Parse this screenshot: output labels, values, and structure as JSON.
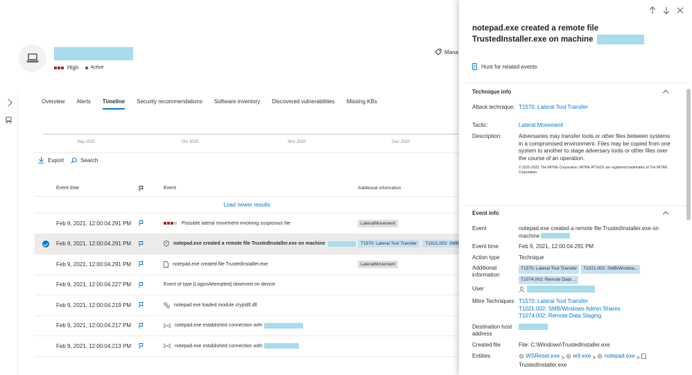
{
  "header": {
    "risk_label": "High",
    "status_label": "Active",
    "manage_label": "Mana"
  },
  "tabs": [
    {
      "label": "Overview",
      "active": false
    },
    {
      "label": "Alerts",
      "active": false
    },
    {
      "label": "Timeline",
      "active": true
    },
    {
      "label": "Security recommendations",
      "active": false
    },
    {
      "label": "Software inventory",
      "active": false
    },
    {
      "label": "Discovered vulnerabilities",
      "active": false
    },
    {
      "label": "Missing KBs",
      "active": false
    }
  ],
  "timeline_axis": [
    "Sep 2020",
    "Oct 2020",
    "Nov 2020",
    "Dec 2020"
  ],
  "toolbar": {
    "export_label": "Export",
    "search_label": "Search"
  },
  "table": {
    "columns": {
      "time": "Event time",
      "event": "Event",
      "info": "Additional information"
    },
    "load_newer": "Load newer results",
    "rows": [
      {
        "time": "Feb 9, 2021, 12:00:04.291 PM",
        "icon": "severity-bars-icon",
        "event": "Possible lateral movement involving suspicious file",
        "tags": [
          "LateralMovement"
        ]
      },
      {
        "time": "Feb 9, 2021, 12:00:04.291 PM",
        "icon": "shield-icon",
        "event": "notepad.exe created a remote file TrustedInstaller.exe on machine",
        "tags": [
          "T1570: Lateral Tool Transfer",
          "T1021.002: SMB/W"
        ]
      },
      {
        "time": "Feb 9, 2021, 12:00:04.291 PM",
        "icon": "file-icon",
        "event": "notepad.exe created file TrustedInstaller.exe",
        "tags": [
          "LateralMovement"
        ]
      },
      {
        "time": "Feb 9, 2021, 12:00:04.227 PM",
        "icon": "",
        "event": "Event of type [LogonAttempted] observed on device",
        "tags": []
      },
      {
        "time": "Feb 9, 2021, 12:00:04.219 PM",
        "icon": "module-icon",
        "event": "notepad.exe loaded module cryptdll.dll",
        "tags": []
      },
      {
        "time": "Feb 9, 2021, 12:00:04.217 PM",
        "icon": "network-icon",
        "event": "notepad.exe established connection with",
        "tags": []
      },
      {
        "time": "Feb 9, 2021, 12:00:04.213 PM",
        "icon": "network-icon",
        "event": "notepad.exe established connection with",
        "tags": []
      }
    ]
  },
  "panel": {
    "title": "notepad.exe created a remote file TrustedInstaller.exe on machine",
    "hunt_label": "Hunt for related events",
    "technique": {
      "heading": "Technique info",
      "attack_label": "Attack technique:",
      "attack_value": "T1570: Lateral Tool Transfer",
      "tactic_label": "Tactic:",
      "tactic_value": "Lateral Movement",
      "desc_label": "Description:",
      "desc_value": "Adversaries may transfer tools or other files between systems in a compromised environment. Files may be copied from one system to another to stage adversary tools or other files over the course of an operation.",
      "copyright": "© 2015-2020, The MITRE Corporation. MITRE ATT&CK are registered trademarks of The MITRE Corporation."
    },
    "event": {
      "heading": "Event info",
      "event_label": "Event",
      "event_value": "notepad.exe created a remote file TrustedInstaller.exe on machine",
      "time_label": "Event time",
      "time_value": "Feb 9, 2021, 12:00:04.291 PM",
      "action_label": "Action type",
      "action_value": "Technique",
      "addl_label": "Additional information",
      "addl_tags": [
        "T1570: Lateral Tool Transfer",
        "T1021.002: SMB/Window...",
        "T1074.002: Remote Data ..."
      ],
      "user_label": "User",
      "mitre_label": "Mitre Techniques",
      "mitre_values": [
        "T1570: Lateral Tool Transfer",
        "T1021.002: SMB/Windows Admin Shares",
        "T1074.002: Remote Data Staging"
      ],
      "dest_label": "Destination host address",
      "created_label": "Created file",
      "created_value": "File: C:\\Windows\\TrustedInstaller.exe",
      "entities_label": "Entities",
      "entities": [
        "WSReset.exe",
        "ie9.exe",
        "notepad.exe",
        "TrustedInstaller.exe"
      ]
    }
  },
  "colors": {
    "accent": "#0078d4",
    "severity_high": "#a4262c",
    "redaction": "#a6dcec",
    "tag_blue": "#c7e0f4"
  }
}
